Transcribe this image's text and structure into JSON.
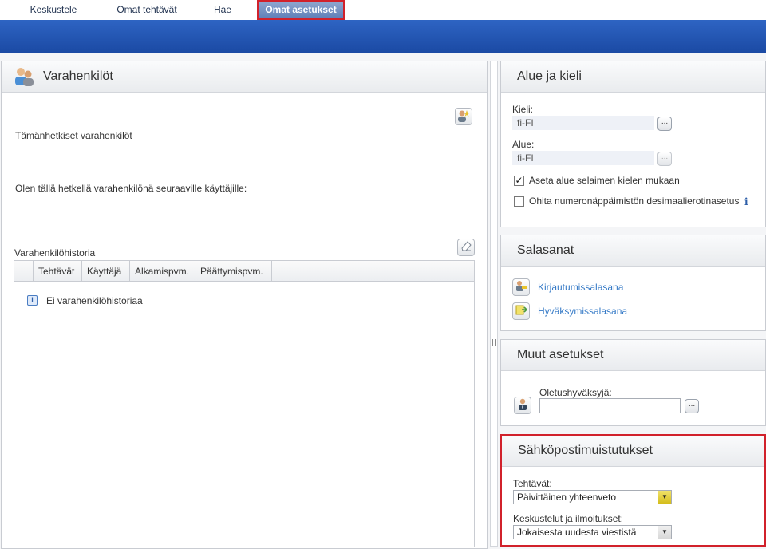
{
  "nav": {
    "tabs": [
      {
        "label": "Keskustele",
        "active": false
      },
      {
        "label": "Omat tehtävät",
        "active": false
      },
      {
        "label": "Hae",
        "active": false
      },
      {
        "label": "Omat asetukset",
        "active": true
      }
    ]
  },
  "substitutes": {
    "title": "Varahenkilöt",
    "current_label": "Tämänhetkiset varahenkilöt",
    "acting_for_label": "Olen tällä hetkellä varahenkilönä seuraaville käyttäjille:",
    "history_label": "Varahenkilöhistoria",
    "columns": [
      "Tehtävät",
      "Käyttäjä",
      "Alkamispvm.",
      "Päättymispvm."
    ],
    "empty_message": "Ei varahenkilöhistoriaa"
  },
  "region": {
    "title": "Alue ja kieli",
    "language_label": "Kieli:",
    "language_value": "fi-FI",
    "locale_label": "Alue:",
    "locale_value": "fi-FI",
    "browser_checkbox_label": "Aseta alue selaimen kielen mukaan",
    "browser_checkbox_checked": true,
    "numpad_checkbox_label": "Ohita numeronäppäimistön desimaalierotinasetus",
    "numpad_checkbox_checked": false,
    "dots_label": "..."
  },
  "passwords": {
    "title": "Salasanat",
    "login_link": "Kirjautumissalasana",
    "approval_link": "Hyväksymissalasana"
  },
  "other": {
    "title": "Muut asetukset",
    "default_approver_label": "Oletushyväksyjä:",
    "default_approver_value": ""
  },
  "email": {
    "title": "Sähköpostimuistutukset",
    "tasks_label": "Tehtävät:",
    "tasks_value": "Päivittäinen yhteenveto",
    "discussions_label": "Keskustelut ja ilmoitukset:",
    "discussions_value": "Jokaisesta uudesta viestistä"
  },
  "colors": {
    "banner": "#1b4aa4",
    "highlight": "#d1212b",
    "link": "#3479c6"
  }
}
